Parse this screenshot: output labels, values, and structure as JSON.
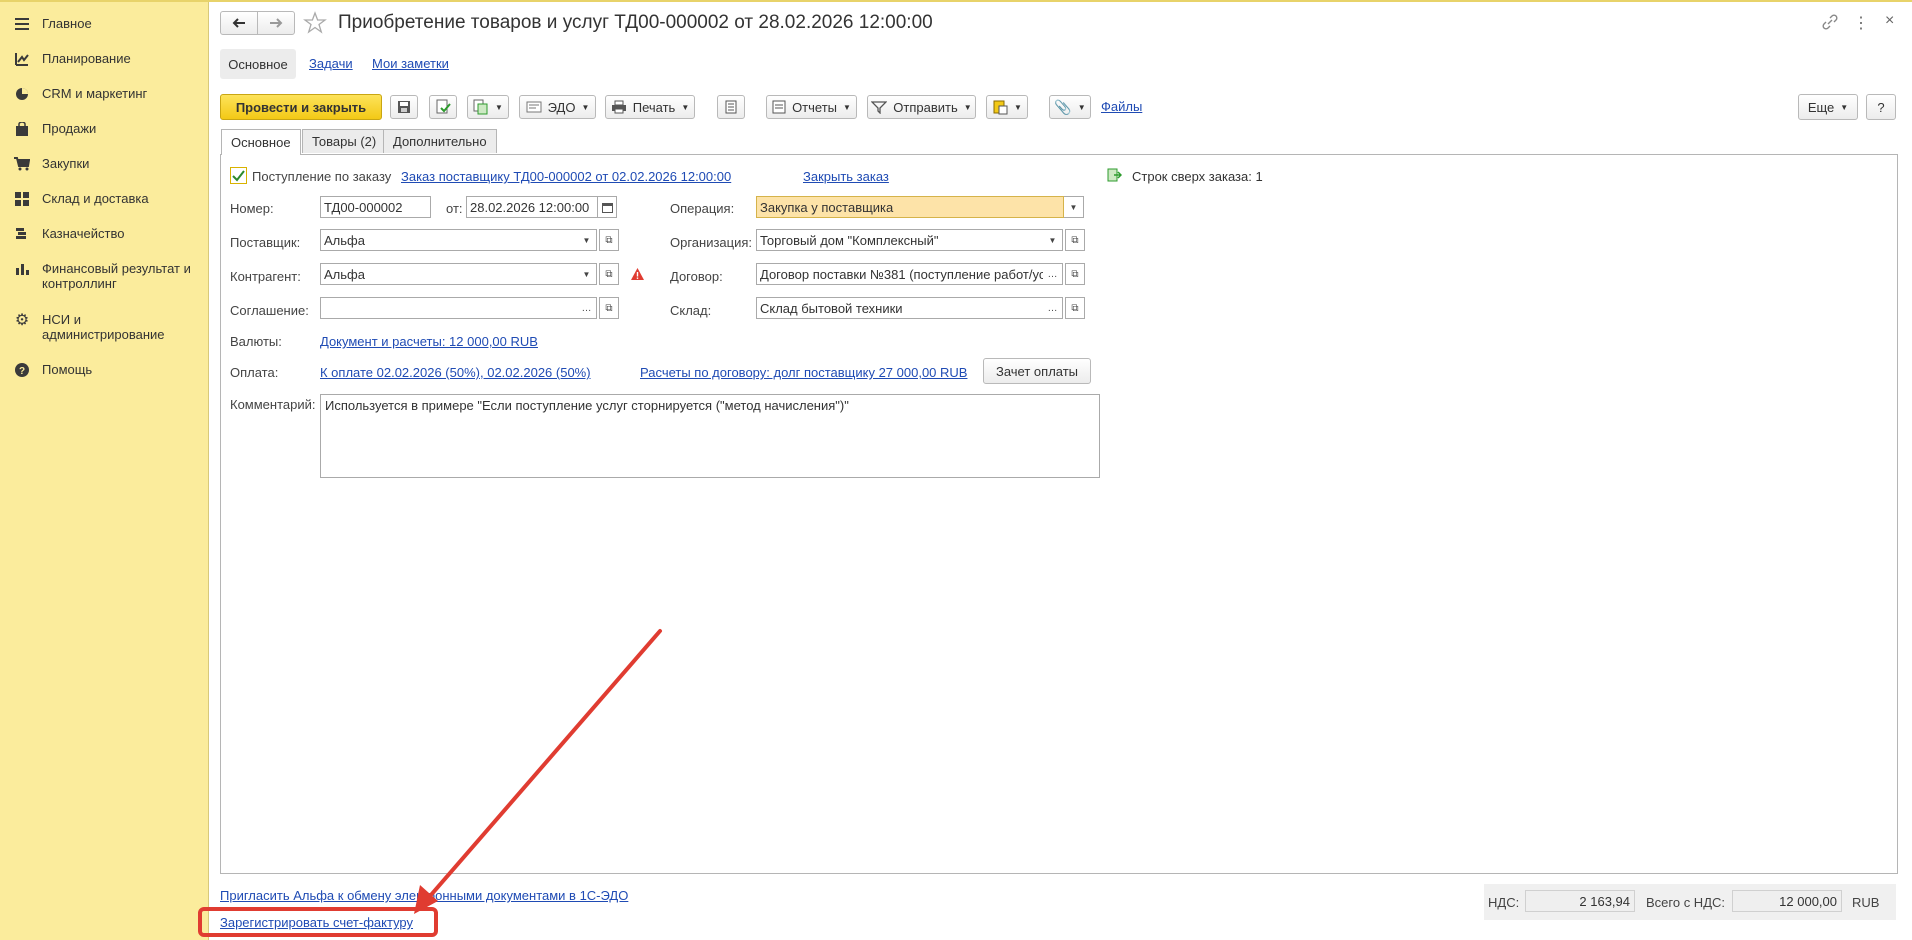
{
  "sidebar": {
    "items": [
      {
        "label": "Главное",
        "icon": "menu-icon"
      },
      {
        "label": "Планирование",
        "icon": "planning-icon"
      },
      {
        "label": "CRM и маркетинг",
        "icon": "pie-chart-icon"
      },
      {
        "label": "Продажи",
        "icon": "bag-icon"
      },
      {
        "label": "Закупки",
        "icon": "cart-icon"
      },
      {
        "label": "Склад и доставка",
        "icon": "warehouse-icon"
      },
      {
        "label": "Казначейство",
        "icon": "coins-icon"
      },
      {
        "label": "Финансовый результат и контроллинг",
        "icon": "bar-chart-icon"
      },
      {
        "label": "НСИ и администрирование",
        "icon": "gear-icon"
      },
      {
        "label": "Помощь",
        "icon": "help-icon"
      }
    ]
  },
  "header": {
    "title": "Приобретение товаров и услуг ТД00-000002 от 28.02.2026 12:00:00"
  },
  "subtabs": {
    "main": "Основное",
    "tasks": "Задачи",
    "notes": "Мои заметки"
  },
  "toolbar": {
    "post_close": "Провести и закрыть",
    "edo": "ЭДО",
    "print": "Печать",
    "reports": "Отчеты",
    "send": "Отправить",
    "files": "Файлы",
    "more": "Еще",
    "help": "?"
  },
  "tabs": {
    "main": "Основное",
    "goods": "Товары (2)",
    "extra": "Дополнительно"
  },
  "form": {
    "by_order_label": "Поступление по заказу",
    "order_link": "Заказ поставщику ТД00-000002 от 02.02.2026 12:00:00",
    "close_order": "Закрыть заказ",
    "over_order": "Строк сверх заказа: 1",
    "number_label": "Номер:",
    "number_value": "ТД00-000002",
    "from_label": "от:",
    "date_value": "28.02.2026 12:00:00",
    "operation_label": "Операция:",
    "operation_value": "Закупка у поставщика",
    "supplier_label": "Поставщик:",
    "supplier_value": "Альфа",
    "organization_label": "Организация:",
    "organization_value": "Торговый дом \"Комплексный\"",
    "counterparty_label": "Контрагент:",
    "counterparty_value": "Альфа",
    "contract_label": "Договор:",
    "contract_value": "Договор поставки №381 (поступление работ/ус",
    "agreement_label": "Соглашение:",
    "agreement_value": "",
    "warehouse_label": "Склад:",
    "warehouse_value": "Склад бытовой техники",
    "currency_label": "Валюты:",
    "currency_link": "Документ и расчеты: 12 000,00 RUB",
    "payment_label": "Оплата:",
    "payment_link": "К оплате 02.02.2026 (50%), 02.02.2026 (50%)",
    "settlements_link": "Расчеты по договору: долг поставщику 27 000,00 RUB",
    "offset_button": "Зачет оплаты",
    "comment_label": "Комментарий:",
    "comment_value": "Используется в примере \"Если поступление услуг сторнируется (\"метод начисления\")\""
  },
  "footer": {
    "invite_link": "Пригласить Альфа к обмену электронными документами в 1С-ЭДО",
    "register_link": "Зарегистрировать счет-фактуру",
    "vat_label": "НДС:",
    "vat_value": "2 163,94",
    "total_label": "Всего с НДС:",
    "total_value": "12 000,00",
    "currency": "RUB"
  },
  "colors": {
    "sidebar_bg": "#fbec9c",
    "primary_button": "#f3c916",
    "link": "#1f4bb4",
    "operation_field_bg": "#fde3a8",
    "annotation_red": "#e03c31"
  }
}
